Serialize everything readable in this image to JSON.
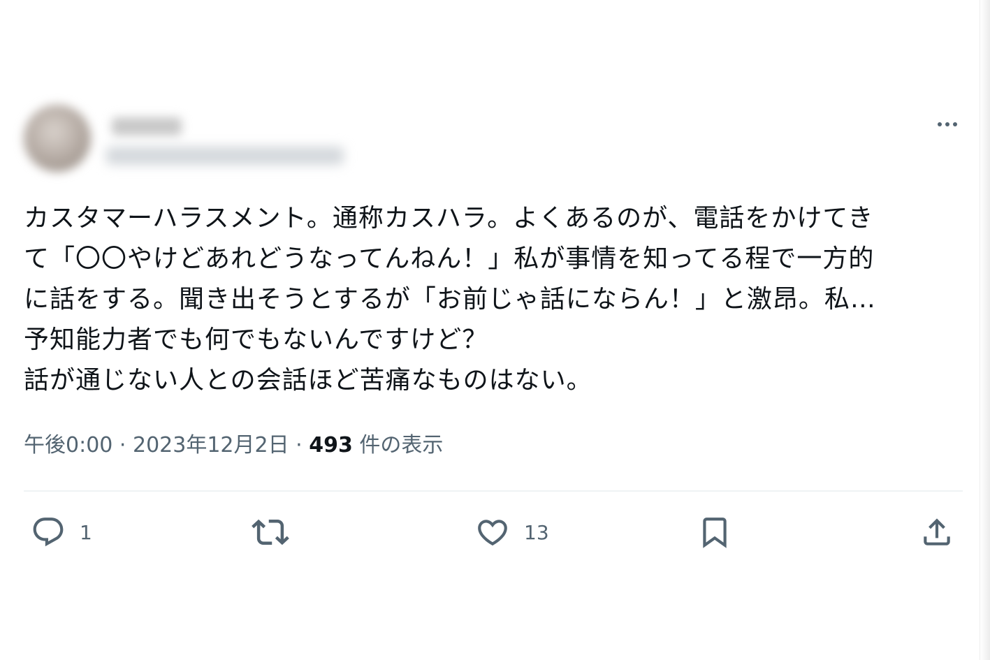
{
  "post": {
    "author": {
      "name": "",
      "handle": ""
    },
    "text_lines": [
      "カスタマーハラスメント。通称カスハラ。よくあるのが、電話をかけてき",
      "て「〇〇やけどあれどうなってんねん！」私が事情を知ってる程で一方的",
      "に話をする。聞き出そうとするが「お前じゃ話にならん！」と激昂。私…",
      "予知能力者でも何でもないんですけど？",
      "話が通じない人との会話ほど苦痛なものはない。"
    ],
    "timestamp": "午後0:00 · 2023年12月2日 · ",
    "views_count": "493",
    "views_label": " 件の表示"
  },
  "actions": {
    "reply_count": "1",
    "repost_count": "",
    "like_count": "13"
  },
  "icons": {
    "more": "more-horizontal-icon",
    "reply": "reply-bubble-icon",
    "repost": "repost-arrows-icon",
    "like": "heart-icon",
    "bookmark": "bookmark-icon",
    "share": "share-upload-icon"
  },
  "colors": {
    "text": "#0f1419",
    "secondary": "#536471",
    "divider": "#eff3f4",
    "background": "#ffffff"
  }
}
